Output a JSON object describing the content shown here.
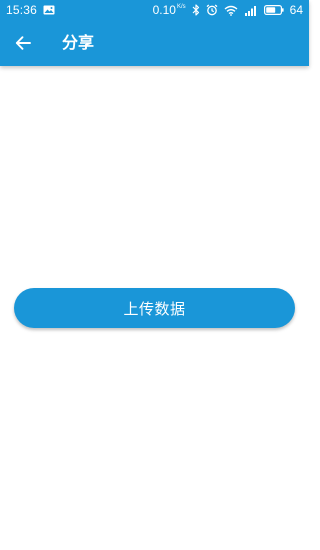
{
  "status_bar": {
    "time": "15:36",
    "notification_icon": "image-icon",
    "network_speed": "0.10",
    "network_speed_unit": "K/s",
    "bluetooth_icon": "bluetooth-icon",
    "alarm_icon": "alarm-icon",
    "wifi_icon": "wifi-icon",
    "signal_icon": "signal-icon",
    "battery_icon": "battery-icon",
    "battery_level": "64"
  },
  "toolbar": {
    "back_icon": "arrow-left-icon",
    "title": "分享"
  },
  "main": {
    "upload_button_label": "上传数据"
  },
  "colors": {
    "primary": "#1a96d8",
    "on_primary": "#ffffff",
    "background": "#ffffff"
  }
}
